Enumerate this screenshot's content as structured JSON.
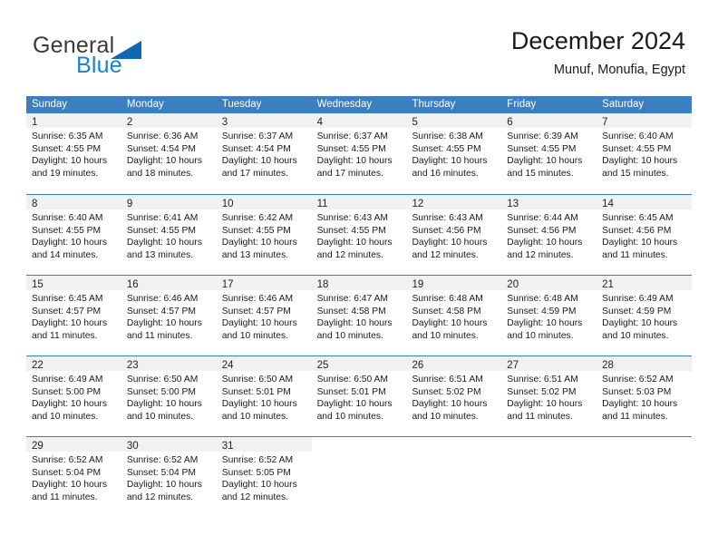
{
  "brand": {
    "name_top": "General",
    "name_bottom": "Blue",
    "color_top": "#3b3b3b",
    "color_bottom": "#1c7fd1",
    "accent": "#1068b3"
  },
  "header": {
    "title": "December 2024",
    "subtitle": "Munuf, Monufia, Egypt"
  },
  "theme": {
    "header_row_bg": "#3c7fc0",
    "day_band_bg": "#f1f1f1",
    "row_divider": "#3c7fc0",
    "text": "#1a1a1a"
  },
  "weekdays": [
    "Sunday",
    "Monday",
    "Tuesday",
    "Wednesday",
    "Thursday",
    "Friday",
    "Saturday"
  ],
  "weeks": [
    [
      {
        "day": "1",
        "sunrise": "Sunrise: 6:35 AM",
        "sunset": "Sunset: 4:55 PM",
        "daylight_line1": "Daylight: 10 hours",
        "daylight_line2": "and 19 minutes."
      },
      {
        "day": "2",
        "sunrise": "Sunrise: 6:36 AM",
        "sunset": "Sunset: 4:54 PM",
        "daylight_line1": "Daylight: 10 hours",
        "daylight_line2": "and 18 minutes."
      },
      {
        "day": "3",
        "sunrise": "Sunrise: 6:37 AM",
        "sunset": "Sunset: 4:54 PM",
        "daylight_line1": "Daylight: 10 hours",
        "daylight_line2": "and 17 minutes."
      },
      {
        "day": "4",
        "sunrise": "Sunrise: 6:37 AM",
        "sunset": "Sunset: 4:55 PM",
        "daylight_line1": "Daylight: 10 hours",
        "daylight_line2": "and 17 minutes."
      },
      {
        "day": "5",
        "sunrise": "Sunrise: 6:38 AM",
        "sunset": "Sunset: 4:55 PM",
        "daylight_line1": "Daylight: 10 hours",
        "daylight_line2": "and 16 minutes."
      },
      {
        "day": "6",
        "sunrise": "Sunrise: 6:39 AM",
        "sunset": "Sunset: 4:55 PM",
        "daylight_line1": "Daylight: 10 hours",
        "daylight_line2": "and 15 minutes."
      },
      {
        "day": "7",
        "sunrise": "Sunrise: 6:40 AM",
        "sunset": "Sunset: 4:55 PM",
        "daylight_line1": "Daylight: 10 hours",
        "daylight_line2": "and 15 minutes."
      }
    ],
    [
      {
        "day": "8",
        "sunrise": "Sunrise: 6:40 AM",
        "sunset": "Sunset: 4:55 PM",
        "daylight_line1": "Daylight: 10 hours",
        "daylight_line2": "and 14 minutes."
      },
      {
        "day": "9",
        "sunrise": "Sunrise: 6:41 AM",
        "sunset": "Sunset: 4:55 PM",
        "daylight_line1": "Daylight: 10 hours",
        "daylight_line2": "and 13 minutes."
      },
      {
        "day": "10",
        "sunrise": "Sunrise: 6:42 AM",
        "sunset": "Sunset: 4:55 PM",
        "daylight_line1": "Daylight: 10 hours",
        "daylight_line2": "and 13 minutes."
      },
      {
        "day": "11",
        "sunrise": "Sunrise: 6:43 AM",
        "sunset": "Sunset: 4:55 PM",
        "daylight_line1": "Daylight: 10 hours",
        "daylight_line2": "and 12 minutes."
      },
      {
        "day": "12",
        "sunrise": "Sunrise: 6:43 AM",
        "sunset": "Sunset: 4:56 PM",
        "daylight_line1": "Daylight: 10 hours",
        "daylight_line2": "and 12 minutes."
      },
      {
        "day": "13",
        "sunrise": "Sunrise: 6:44 AM",
        "sunset": "Sunset: 4:56 PM",
        "daylight_line1": "Daylight: 10 hours",
        "daylight_line2": "and 12 minutes."
      },
      {
        "day": "14",
        "sunrise": "Sunrise: 6:45 AM",
        "sunset": "Sunset: 4:56 PM",
        "daylight_line1": "Daylight: 10 hours",
        "daylight_line2": "and 11 minutes."
      }
    ],
    [
      {
        "day": "15",
        "sunrise": "Sunrise: 6:45 AM",
        "sunset": "Sunset: 4:57 PM",
        "daylight_line1": "Daylight: 10 hours",
        "daylight_line2": "and 11 minutes."
      },
      {
        "day": "16",
        "sunrise": "Sunrise: 6:46 AM",
        "sunset": "Sunset: 4:57 PM",
        "daylight_line1": "Daylight: 10 hours",
        "daylight_line2": "and 11 minutes."
      },
      {
        "day": "17",
        "sunrise": "Sunrise: 6:46 AM",
        "sunset": "Sunset: 4:57 PM",
        "daylight_line1": "Daylight: 10 hours",
        "daylight_line2": "and 10 minutes."
      },
      {
        "day": "18",
        "sunrise": "Sunrise: 6:47 AM",
        "sunset": "Sunset: 4:58 PM",
        "daylight_line1": "Daylight: 10 hours",
        "daylight_line2": "and 10 minutes."
      },
      {
        "day": "19",
        "sunrise": "Sunrise: 6:48 AM",
        "sunset": "Sunset: 4:58 PM",
        "daylight_line1": "Daylight: 10 hours",
        "daylight_line2": "and 10 minutes."
      },
      {
        "day": "20",
        "sunrise": "Sunrise: 6:48 AM",
        "sunset": "Sunset: 4:59 PM",
        "daylight_line1": "Daylight: 10 hours",
        "daylight_line2": "and 10 minutes."
      },
      {
        "day": "21",
        "sunrise": "Sunrise: 6:49 AM",
        "sunset": "Sunset: 4:59 PM",
        "daylight_line1": "Daylight: 10 hours",
        "daylight_line2": "and 10 minutes."
      }
    ],
    [
      {
        "day": "22",
        "sunrise": "Sunrise: 6:49 AM",
        "sunset": "Sunset: 5:00 PM",
        "daylight_line1": "Daylight: 10 hours",
        "daylight_line2": "and 10 minutes."
      },
      {
        "day": "23",
        "sunrise": "Sunrise: 6:50 AM",
        "sunset": "Sunset: 5:00 PM",
        "daylight_line1": "Daylight: 10 hours",
        "daylight_line2": "and 10 minutes."
      },
      {
        "day": "24",
        "sunrise": "Sunrise: 6:50 AM",
        "sunset": "Sunset: 5:01 PM",
        "daylight_line1": "Daylight: 10 hours",
        "daylight_line2": "and 10 minutes."
      },
      {
        "day": "25",
        "sunrise": "Sunrise: 6:50 AM",
        "sunset": "Sunset: 5:01 PM",
        "daylight_line1": "Daylight: 10 hours",
        "daylight_line2": "and 10 minutes."
      },
      {
        "day": "26",
        "sunrise": "Sunrise: 6:51 AM",
        "sunset": "Sunset: 5:02 PM",
        "daylight_line1": "Daylight: 10 hours",
        "daylight_line2": "and 10 minutes."
      },
      {
        "day": "27",
        "sunrise": "Sunrise: 6:51 AM",
        "sunset": "Sunset: 5:02 PM",
        "daylight_line1": "Daylight: 10 hours",
        "daylight_line2": "and 11 minutes."
      },
      {
        "day": "28",
        "sunrise": "Sunrise: 6:52 AM",
        "sunset": "Sunset: 5:03 PM",
        "daylight_line1": "Daylight: 10 hours",
        "daylight_line2": "and 11 minutes."
      }
    ],
    [
      {
        "day": "29",
        "sunrise": "Sunrise: 6:52 AM",
        "sunset": "Sunset: 5:04 PM",
        "daylight_line1": "Daylight: 10 hours",
        "daylight_line2": "and 11 minutes."
      },
      {
        "day": "30",
        "sunrise": "Sunrise: 6:52 AM",
        "sunset": "Sunset: 5:04 PM",
        "daylight_line1": "Daylight: 10 hours",
        "daylight_line2": "and 12 minutes."
      },
      {
        "day": "31",
        "sunrise": "Sunrise: 6:52 AM",
        "sunset": "Sunset: 5:05 PM",
        "daylight_line1": "Daylight: 10 hours",
        "daylight_line2": "and 12 minutes."
      },
      {
        "day": "",
        "sunrise": "",
        "sunset": "",
        "daylight_line1": "",
        "daylight_line2": ""
      },
      {
        "day": "",
        "sunrise": "",
        "sunset": "",
        "daylight_line1": "",
        "daylight_line2": ""
      },
      {
        "day": "",
        "sunrise": "",
        "sunset": "",
        "daylight_line1": "",
        "daylight_line2": ""
      },
      {
        "day": "",
        "sunrise": "",
        "sunset": "",
        "daylight_line1": "",
        "daylight_line2": ""
      }
    ]
  ]
}
